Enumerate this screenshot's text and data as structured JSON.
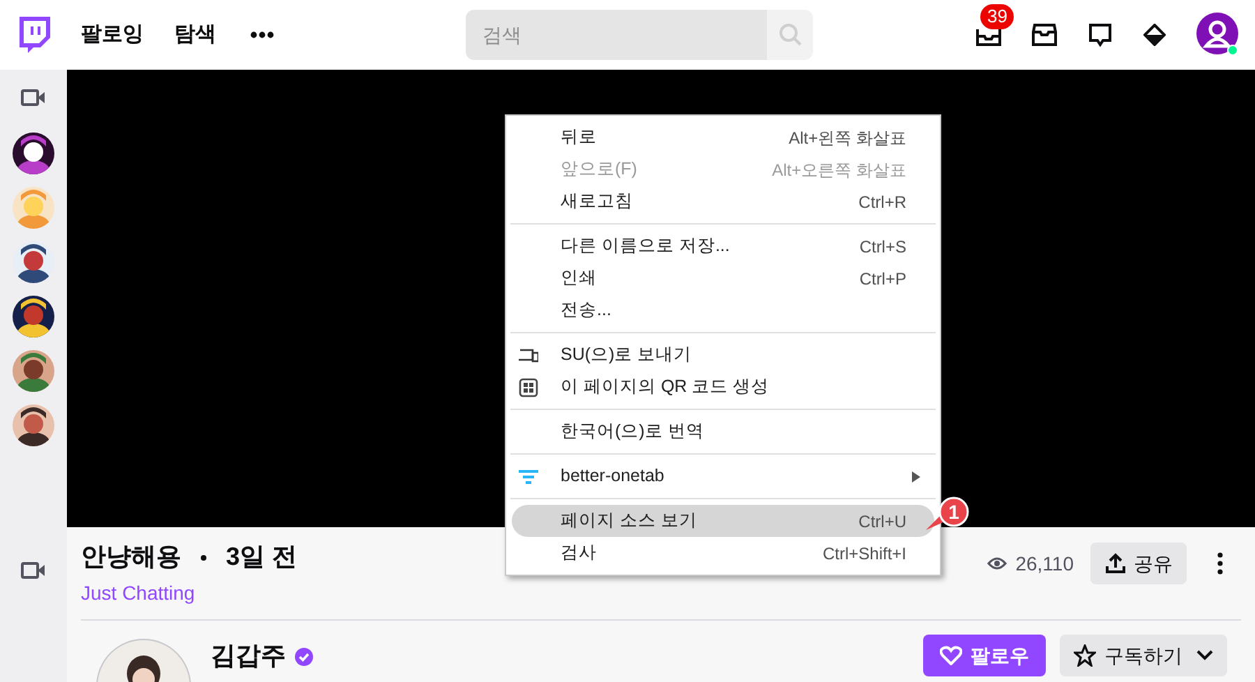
{
  "top_nav": {
    "links": [
      "팔로잉",
      "탐색"
    ],
    "search": {
      "placeholder": "검색"
    },
    "notification_badge": "39"
  },
  "context_menu": {
    "groups": [
      [
        {
          "label": "뒤로",
          "shortcut": "Alt+왼쪽 화살표",
          "disabled": false,
          "selected": false
        },
        {
          "label": "앞으로(F)",
          "shortcut": "Alt+오른쪽 화살표",
          "disabled": true,
          "selected": false
        },
        {
          "label": "새로고침",
          "shortcut": "Ctrl+R",
          "disabled": false,
          "selected": false
        }
      ],
      [
        {
          "label": "다른 이름으로 저장...",
          "shortcut": "Ctrl+S",
          "disabled": false,
          "selected": false
        },
        {
          "label": "인쇄",
          "shortcut": "Ctrl+P",
          "disabled": false,
          "selected": false
        },
        {
          "label": "전송...",
          "disabled": false,
          "selected": false
        }
      ],
      [
        {
          "label": "SU(으)로 보내기",
          "kind": "device",
          "disabled": false,
          "selected": false
        },
        {
          "label": "이 페이지의 QR 코드 생성",
          "kind": "qr",
          "disabled": false,
          "selected": false
        }
      ],
      [
        {
          "label": "한국어(으)로 번역",
          "disabled": false,
          "selected": false
        }
      ],
      [
        {
          "label": "better-onetab",
          "kind": "extension",
          "submenu": true,
          "disabled": false,
          "selected": false
        }
      ],
      [
        {
          "label": "페이지 소스 보기",
          "shortcut": "Ctrl+U",
          "disabled": false,
          "selected": true
        },
        {
          "label": "검사",
          "shortcut": "Ctrl+Shift+I",
          "disabled": false,
          "selected": false
        }
      ]
    ]
  },
  "annotation": {
    "number": "1"
  },
  "video_info": {
    "title": "안냥해용",
    "age": "3일 전",
    "category": "Just Chatting",
    "views": "26,110",
    "share_button": "공유",
    "channel_name": "김갑주",
    "verified": true,
    "follow_button": "팔로우",
    "subscribe_button": "구독하기"
  }
}
